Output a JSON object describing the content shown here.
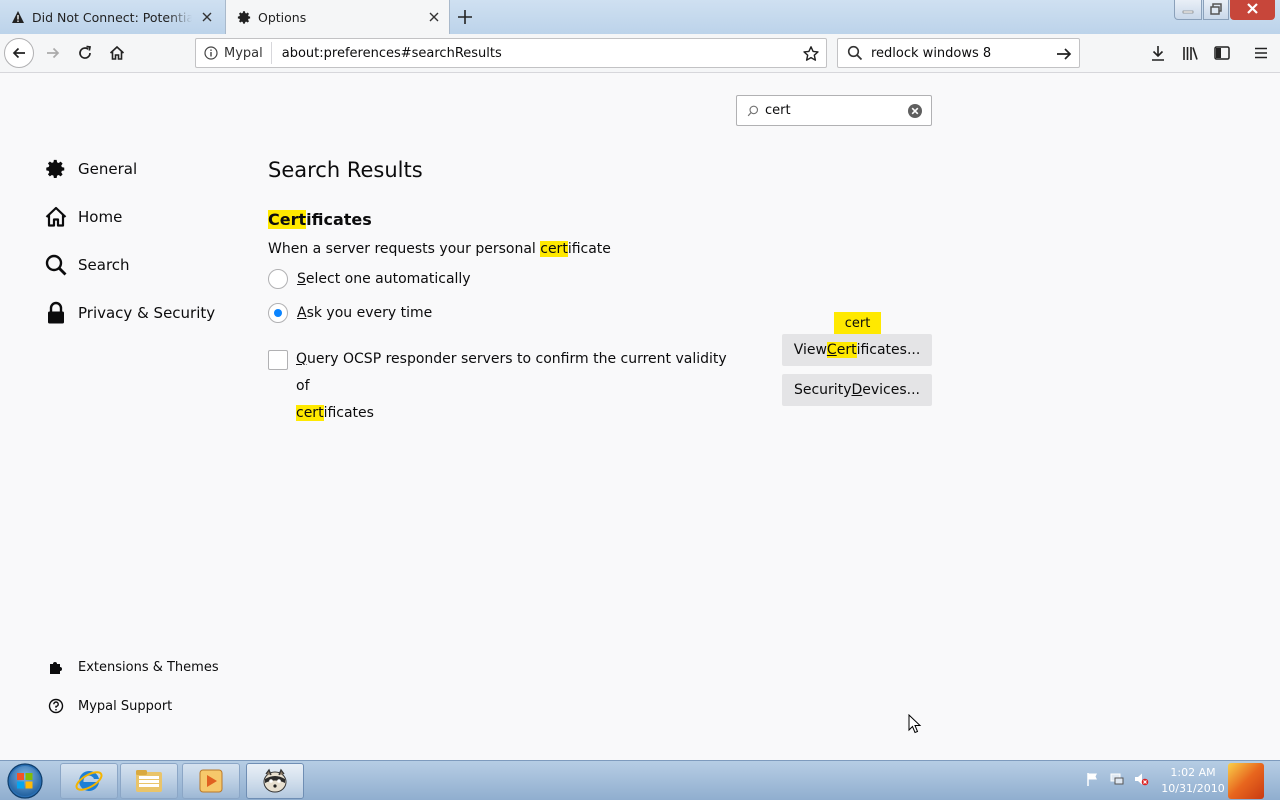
{
  "tabs": [
    {
      "title": "Did Not Connect: Potential Security Issue",
      "icon": "warning-icon"
    },
    {
      "title": "Options",
      "icon": "gear-icon"
    }
  ],
  "navbar": {
    "identity_label": "Mypal",
    "url": "about:preferences#searchResults",
    "search_value": "redlock windows 8"
  },
  "prefs_search": {
    "value": "cert"
  },
  "categories": [
    {
      "label": "General",
      "icon": "gear-icon"
    },
    {
      "label": "Home",
      "icon": "home-icon"
    },
    {
      "label": "Search",
      "icon": "search-icon"
    },
    {
      "label": "Privacy & Security",
      "icon": "lock-icon"
    }
  ],
  "footer_links": [
    {
      "label": "Extensions & Themes",
      "icon": "puzzle-icon"
    },
    {
      "label": "Mypal Support",
      "icon": "help-icon"
    }
  ],
  "results": {
    "page_title": "Search Results",
    "section_title_hl": "Cert",
    "section_title_rest": "ificates",
    "desc_pre": "When a server requests your personal ",
    "desc_hl": "cert",
    "desc_post": "ificate",
    "radio_auto_key": "S",
    "radio_auto_rest": "elect one automatically",
    "radio_ask_key": "A",
    "radio_ask_rest": "sk you every time",
    "ocsp_key": "Q",
    "ocsp_line1_rest": "uery OCSP responder servers to confirm the current validity of",
    "ocsp_hl": "cert",
    "ocsp_post": "ificates",
    "view_btn_pre": "View ",
    "view_btn_hl_key": "C",
    "view_btn_hl_rest": "ert",
    "view_btn_post": "ificates...",
    "security_btn_pre": "Security ",
    "security_btn_key": "D",
    "security_btn_post": "evices...",
    "tooltip": "cert",
    "radio_selected": "ask"
  },
  "taskbar": {
    "time": "1:02 AM",
    "date": "10/31/2010"
  },
  "colors": {
    "highlight": "#ffe900",
    "accent": "#0a84ff"
  }
}
